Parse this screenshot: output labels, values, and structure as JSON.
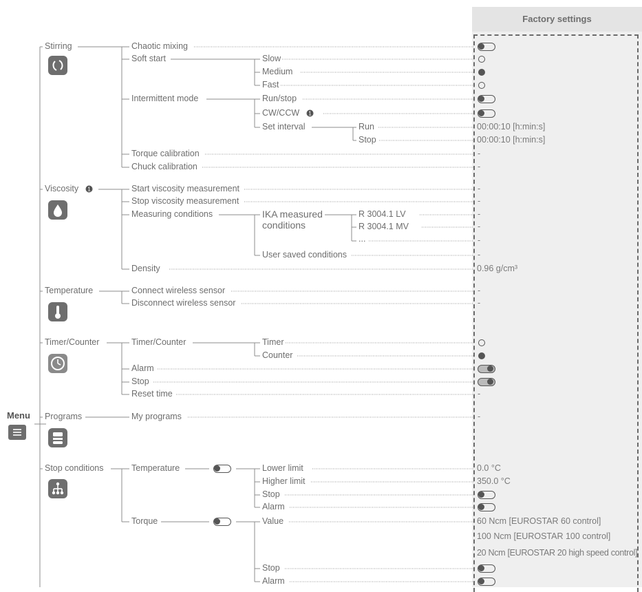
{
  "header": {
    "factory_settings": "Factory settings"
  },
  "menu_label": "Menu",
  "tree": {
    "stirring": "Stirring",
    "chaotic_mixing": "Chaotic mixing",
    "soft_start": "Soft start",
    "slow": "Slow",
    "medium": "Medium",
    "fast": "Fast",
    "intermittent_mode": "Intermittent mode",
    "run_stop": "Run/stop",
    "cw_ccw": "CW/CCW",
    "set_interval": "Set interval",
    "run": "Run",
    "stop": "Stop",
    "torque_calibration": "Torque calibration",
    "chuck_calibration": "Chuck calibration",
    "viscosity": "Viscosity",
    "start_viscosity": "Start viscosity measurement",
    "stop_viscosity": "Stop viscosity measurement",
    "measuring_conditions": "Measuring conditions",
    "ika_measured_1": "IKA measured",
    "ika_measured_2": "conditions",
    "r3004_lv": "R 3004.1 LV",
    "r3004_mv": "R 3004.1 MV",
    "ellipsis": "...",
    "user_saved": "User saved conditions",
    "density": "Density",
    "temperature": "Temperature",
    "connect_sensor": "Connect wireless sensor",
    "disconnect_sensor": "Disconnect wireless sensor",
    "timer_counter": "Timer/Counter",
    "timer_counter_sub": "Timer/Counter",
    "timer": "Timer",
    "counter": "Counter",
    "alarm": "Alarm",
    "stop_tc": "Stop",
    "reset_time": "Reset time",
    "programs": "Programs",
    "my_programs": "My programs",
    "stop_conditions": "Stop conditions",
    "sc_temperature": "Temperature",
    "lower_limit": "Lower limit",
    "higher_limit": "Higher limit",
    "sc_stop": "Stop",
    "sc_alarm": "Alarm",
    "torque": "Torque",
    "value": "Value",
    "tq_stop": "Stop",
    "tq_alarm": "Alarm"
  },
  "factory": {
    "interval_run": "00:00:10 [h:min:s]",
    "interval_stop": "00:00:10 [h:min:s]",
    "dash": "-",
    "density": "0.96 g/cm³",
    "lower_limit": "0.0 °C",
    "higher_limit": "350.0 °C",
    "value_60": "60 Ncm [EUROSTAR 60 control]",
    "value_100": "100 Ncm [EUROSTAR 100 control]",
    "value_20": "20 Ncm [EUROSTAR 20 high speed control]"
  },
  "icons": {
    "stirring": "stirring-icon",
    "viscosity": "drop-icon",
    "temperature": "thermometer-icon",
    "timer": "clock-icon",
    "programs": "programs-icon",
    "stop_conditions": "hierarchy-icon",
    "menu": "menu-icon",
    "info": "info-icon"
  },
  "colors": {
    "line": "#8c8c8c",
    "text": "#6e6e6e",
    "panel": "#efefef",
    "icon": "#6e6e6e"
  }
}
